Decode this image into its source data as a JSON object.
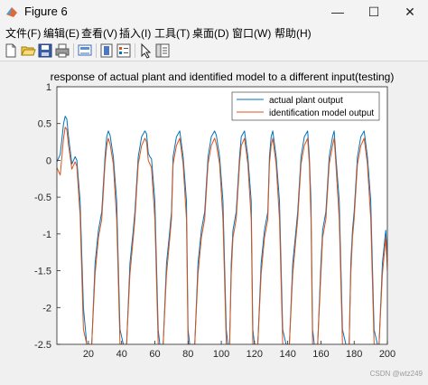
{
  "window": {
    "title": "Figure 6",
    "minimize_glyph": "—",
    "maximize_glyph": "☐",
    "close_glyph": "✕"
  },
  "menu": [
    {
      "label": "文件(F)"
    },
    {
      "label": "编辑(E)"
    },
    {
      "label": "查看(V)"
    },
    {
      "label": "插入(I)"
    },
    {
      "label": "工具(T)"
    },
    {
      "label": "桌面(D)"
    },
    {
      "label": "窗口(W)"
    },
    {
      "label": "帮助(H)"
    }
  ],
  "toolbar": {
    "icons": [
      "new-figure-icon",
      "open-file-icon",
      "save-icon",
      "print-icon",
      "link-plot-icon",
      "insert-colorbar-icon",
      "insert-legend-icon",
      "edit-plot-arrow-icon",
      "property-editor-icon"
    ]
  },
  "chart_data": {
    "type": "line",
    "title": "response of actual plant and identified model to a different input(testing)",
    "xlabel": "",
    "ylabel": "",
    "xlim": [
      1,
      200
    ],
    "ylim": [
      -2.5,
      1
    ],
    "xticks": [
      "20",
      "40",
      "60",
      "80",
      "100",
      "120",
      "140",
      "160",
      "180",
      "200"
    ],
    "yticks": [
      "1",
      "0.5",
      "0",
      "-0.5",
      "-1",
      "-1.5",
      "-2",
      "-2.5"
    ],
    "grid": false,
    "legend_position": "top-right",
    "colors": {
      "actual": "#0072bd",
      "identified": "#d95319"
    },
    "series": [
      {
        "name": "actual plant output",
        "x": [
          1,
          3,
          5,
          6,
          7,
          8,
          10,
          12,
          13,
          15,
          17,
          19,
          21,
          22,
          24,
          26,
          28,
          30,
          31,
          32,
          33,
          35,
          37,
          39,
          41,
          43,
          45,
          47,
          48,
          50,
          52,
          54,
          55,
          56,
          57,
          58,
          60,
          62,
          63,
          65,
          67,
          69,
          70,
          71,
          73,
          75,
          77,
          79,
          80,
          81,
          82,
          84,
          86,
          88,
          90,
          92,
          94,
          96,
          97,
          99,
          101,
          103,
          104,
          105,
          106,
          107,
          109,
          111,
          112,
          114,
          116,
          118,
          119,
          120,
          122,
          124,
          126,
          128,
          129,
          130,
          131,
          133,
          135,
          137,
          139,
          141,
          143,
          145,
          146,
          148,
          150,
          152,
          153,
          154,
          155,
          156,
          158,
          160,
          161,
          163,
          165,
          167,
          168,
          169,
          171,
          173,
          175,
          177,
          178,
          179,
          180,
          182,
          184,
          186,
          188,
          190,
          192,
          194,
          195,
          197,
          199,
          200
        ],
        "values": [
          -0.02,
          0.08,
          0.5,
          0.6,
          0.56,
          0.32,
          -0.05,
          0.05,
          0.0,
          -0.55,
          -2.0,
          -2.5,
          -2.5,
          -2.5,
          -1.4,
          -0.95,
          -0.7,
          0.05,
          0.32,
          0.4,
          0.34,
          0.05,
          -0.55,
          -2.3,
          -2.5,
          -2.5,
          -1.4,
          -0.95,
          -0.7,
          0.05,
          0.32,
          0.4,
          0.36,
          0.1,
          0.05,
          0.02,
          -0.55,
          -2.3,
          -2.5,
          -2.5,
          -1.4,
          -0.95,
          -0.7,
          0.05,
          0.32,
          0.4,
          0.05,
          -0.55,
          -2.3,
          -2.5,
          -2.5,
          -2.5,
          -1.4,
          -0.95,
          -0.7,
          0.05,
          0.32,
          0.4,
          0.34,
          0.05,
          -0.55,
          -2.3,
          -2.5,
          -2.5,
          -1.4,
          -0.95,
          -0.7,
          0.05,
          0.32,
          0.4,
          0.05,
          -0.55,
          -2.3,
          -2.5,
          -2.5,
          -1.4,
          -0.95,
          -0.7,
          0.05,
          0.32,
          0.4,
          0.05,
          -0.55,
          -2.3,
          -2.5,
          -2.5,
          -1.4,
          -0.95,
          -0.7,
          0.05,
          0.32,
          0.4,
          0.05,
          -0.55,
          -2.3,
          -2.5,
          -2.5,
          -1.4,
          -0.95,
          -0.7,
          0.05,
          0.32,
          0.4,
          0.05,
          -0.55,
          -2.3,
          -2.5,
          -2.5,
          -1.4,
          -0.95,
          -0.7,
          0.05,
          0.32,
          0.4,
          0.05,
          -0.55,
          -2.3,
          -2.5,
          -2.5,
          -1.4,
          -0.95,
          -1.3
        ]
      },
      {
        "name": "identification model output",
        "x": [
          1,
          3,
          5,
          6,
          7,
          8,
          10,
          12,
          13,
          15,
          17,
          19,
          21,
          22,
          24,
          26,
          28,
          30,
          31,
          32,
          33,
          35,
          37,
          39,
          41,
          43,
          45,
          47,
          48,
          50,
          52,
          54,
          55,
          56,
          57,
          58,
          60,
          62,
          63,
          65,
          67,
          69,
          70,
          71,
          73,
          75,
          77,
          79,
          80,
          81,
          82,
          84,
          86,
          88,
          90,
          92,
          94,
          96,
          97,
          99,
          101,
          103,
          104,
          105,
          106,
          107,
          109,
          111,
          112,
          114,
          116,
          118,
          119,
          120,
          122,
          124,
          126,
          128,
          129,
          130,
          131,
          133,
          135,
          137,
          139,
          141,
          143,
          145,
          146,
          148,
          150,
          152,
          153,
          154,
          155,
          156,
          158,
          160,
          161,
          163,
          165,
          167,
          168,
          169,
          171,
          173,
          175,
          177,
          178,
          179,
          180,
          182,
          184,
          186,
          188,
          190,
          192,
          194,
          195,
          197,
          199,
          200
        ],
        "values": [
          -0.1,
          -0.2,
          0.3,
          0.45,
          0.42,
          0.2,
          -0.12,
          -0.02,
          -0.08,
          -0.75,
          -2.3,
          -2.5,
          -2.5,
          -2.5,
          -1.55,
          -1.05,
          -0.8,
          -0.05,
          0.2,
          0.3,
          0.22,
          -0.05,
          -0.8,
          -2.5,
          -2.5,
          -2.5,
          -1.55,
          -1.05,
          -0.8,
          -0.05,
          0.2,
          0.3,
          0.25,
          0.0,
          -0.05,
          -0.1,
          -0.8,
          -2.5,
          -2.5,
          -2.5,
          -1.55,
          -1.05,
          -0.8,
          -0.05,
          0.2,
          0.3,
          -0.05,
          -0.8,
          -2.5,
          -2.5,
          -2.5,
          -2.5,
          -1.55,
          -1.05,
          -0.8,
          -0.05,
          0.2,
          0.3,
          0.22,
          -0.05,
          -0.8,
          -2.5,
          -2.5,
          -2.5,
          -1.55,
          -1.05,
          -0.8,
          -0.05,
          0.2,
          0.3,
          -0.05,
          -0.8,
          -2.5,
          -2.5,
          -2.5,
          -1.55,
          -1.05,
          -0.8,
          -0.05,
          0.2,
          0.3,
          -0.05,
          -0.8,
          -2.5,
          -2.5,
          -2.5,
          -1.55,
          -1.05,
          -0.8,
          -0.05,
          0.2,
          0.3,
          -0.05,
          -0.8,
          -2.5,
          -2.5,
          -2.5,
          -1.55,
          -1.05,
          -0.8,
          -0.05,
          0.2,
          0.3,
          -0.05,
          -0.8,
          -2.5,
          -2.5,
          -2.5,
          -1.55,
          -1.05,
          -0.8,
          -0.05,
          0.2,
          0.3,
          -0.05,
          -0.8,
          -2.5,
          -2.5,
          -2.5,
          -1.55,
          -1.05,
          -1.5
        ]
      }
    ]
  },
  "watermark": "CSDN @wtz249"
}
